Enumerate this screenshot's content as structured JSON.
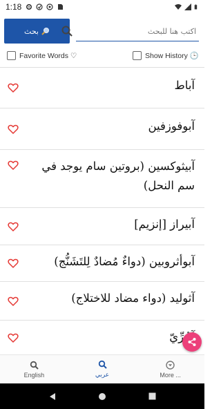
{
  "status_bar": {
    "time": "1:18",
    "icons": [
      "settings-icon",
      "notification-icon",
      "vpn-icon",
      "sim-icon",
      "wifi-icon",
      "signal-icon",
      "battery-icon"
    ]
  },
  "search": {
    "button_label": "بحث",
    "placeholder": "اكتب هنا للبحث"
  },
  "options": {
    "favorite_label": "Favorite Words ♡",
    "history_label": "Show History 🕒"
  },
  "words": [
    {
      "text": "آباط"
    },
    {
      "text": "آبوفوزفين"
    },
    {
      "text": "آبيثوكسين (بروتين سام يوجد في سم النحل)"
    },
    {
      "text": "آبيراز [إنزيم]"
    },
    {
      "text": "آبوأثروبين (دواءٌ مُضادٌ لِلتَشَنُّج)"
    },
    {
      "text": "آثوليد (دواء مضاد للاختلاج)"
    },
    {
      "text": "آجُرِّيّ"
    }
  ],
  "nav": {
    "english": "English",
    "arabic": "عربي",
    "more": "More ..."
  },
  "colors": {
    "accent": "#1e55a8",
    "heart": "#e53935",
    "fab": "#ec407a"
  }
}
